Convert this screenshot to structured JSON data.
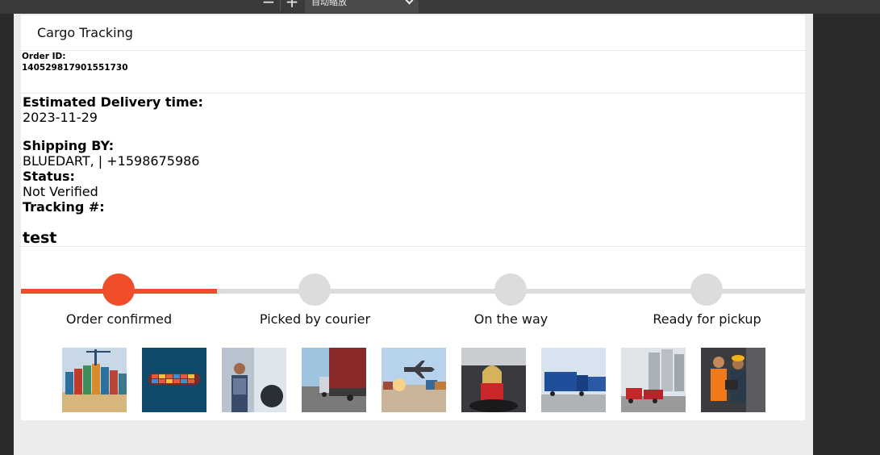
{
  "viewer": {
    "zoom_value": "自动缩放"
  },
  "header": {
    "title": "Cargo Tracking"
  },
  "order": {
    "id_label": "Order ID:",
    "id_value": "140529817901551730"
  },
  "info": {
    "delivery_label": "Estimated Delivery time:",
    "delivery_value": "2023-11-29",
    "shipping_label": "Shipping BY:",
    "shipping_value": "BLUEDART, | +1598675986",
    "status_label": "Status:",
    "status_value": "Not Verified",
    "tracking_label": "Tracking #:",
    "tracking_value": "test"
  },
  "tracker": {
    "progress": 0.25,
    "accent_color": "#f04e2b",
    "steps": [
      {
        "label": "Order confirmed",
        "active": true
      },
      {
        "label": "Picked by courier",
        "active": false
      },
      {
        "label": "On the way",
        "active": false
      },
      {
        "label": "Ready for pickup",
        "active": false
      }
    ]
  },
  "gallery": {
    "images": [
      "container-port-image",
      "cargo-ship-image",
      "truck-driver-image",
      "red-truck-image",
      "airplane-containers-image",
      "female-driver-image",
      "blue-trucks-image",
      "red-trucks-silos-image",
      "warehouse-workers-image"
    ]
  }
}
